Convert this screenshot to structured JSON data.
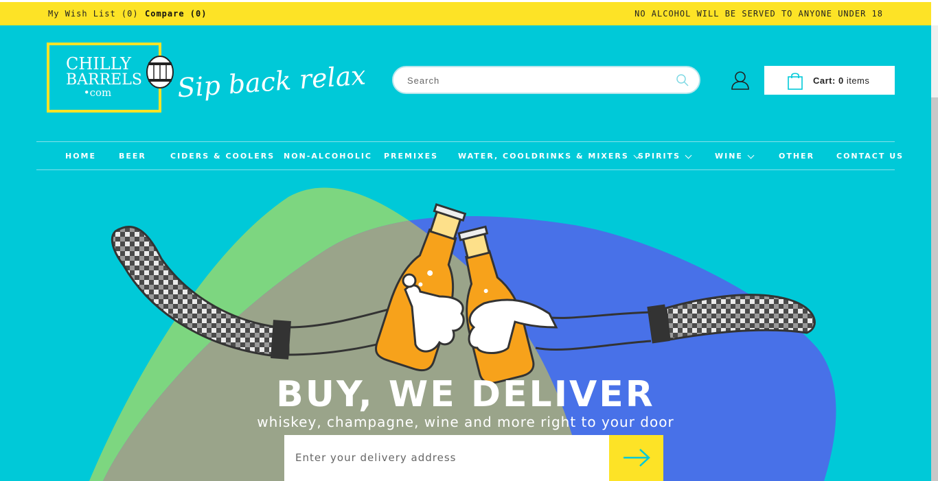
{
  "topbar": {
    "wishlist": "My Wish List (0)",
    "compare": "Compare (0)",
    "notice": "NO ALCOHOL WILL BE SERVED TO ANYONE UNDER 18"
  },
  "logo": {
    "line1": "CHILLY",
    "line2": "BARRELS",
    "line3": "•com",
    "tagline": "Sip back relax"
  },
  "search": {
    "placeholder": "Search"
  },
  "cart": {
    "label": "Cart:",
    "count": "0",
    "unit": "items"
  },
  "nav": {
    "items": [
      {
        "label": "HOME"
      },
      {
        "label": "BEER"
      },
      {
        "label": "CIDERS & COOLERS"
      },
      {
        "label": "NON-ALCOHOLIC"
      },
      {
        "label": "PREMIXES"
      },
      {
        "label": "WATER, COOLDRINKS & MIXERS"
      },
      {
        "label": "SPIRITS"
      },
      {
        "label": "WINE"
      },
      {
        "label": "OTHER"
      },
      {
        "label": "CONTACT US"
      }
    ]
  },
  "hero": {
    "title": "BUY, WE DELIVER",
    "subtitle": "whiskey, champagne, wine and more right to your door",
    "address_placeholder": "Enter your delivery address"
  },
  "colors": {
    "teal": "#00c9d8",
    "yellow": "#fde326",
    "blob_green": "#7dd680",
    "blob_blue": "#4871e8",
    "blob_olive": "#9aa48a",
    "bottle_orange": "#f7a21b"
  },
  "icons": {
    "search": "search-icon",
    "user": "user-icon",
    "cart": "shopping-bag-icon",
    "submit": "arrow-right-icon",
    "dropdown": "chevron-down-icon"
  }
}
